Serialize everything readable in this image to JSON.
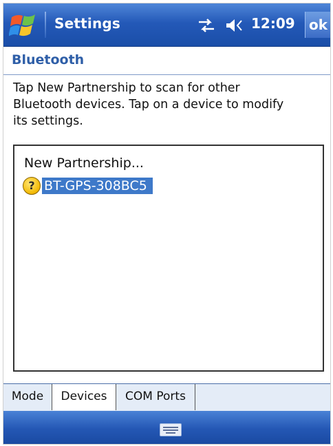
{
  "titlebar": {
    "app_title": "Settings",
    "time": "12:09",
    "ok_label": "ok",
    "icons": [
      "windows-start-icon",
      "connectivity-icon",
      "volume-icon"
    ]
  },
  "page": {
    "heading": "Bluetooth",
    "instructions": [
      "Tap New Partnership to scan for other",
      "Bluetooth devices. Tap on a device to modify",
      "its settings."
    ]
  },
  "device_list": {
    "items": [
      {
        "label": "New Partnership...",
        "icon": null,
        "selected": false
      },
      {
        "label": "BT-GPS-308BC5",
        "icon": "unknown-device-icon",
        "selected": true
      }
    ]
  },
  "tabs": [
    {
      "label": "Mode",
      "active": false
    },
    {
      "label": "Devices",
      "active": true
    },
    {
      "label": "COM Ports",
      "active": false
    }
  ],
  "menubar": {
    "icon": "keyboard-icon"
  },
  "colors": {
    "title_bar": "#2459b8",
    "heading_text": "#2f5fa8",
    "selection": "#3e79c9"
  }
}
